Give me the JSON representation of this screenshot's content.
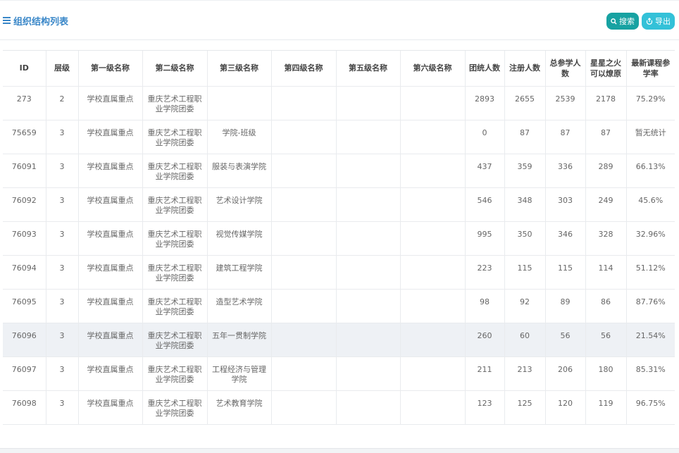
{
  "header": {
    "title": "组织结构列表",
    "search_label": "搜索",
    "export_label": "导出"
  },
  "colors": {
    "title": "#3a87c8",
    "search_button": "#17a2a2",
    "export_button": "#33c1d8",
    "highlight_row": "#eef1f5"
  },
  "table": {
    "columns": [
      "ID",
      "层级",
      "第一级名称",
      "第二级名称",
      "第三级名称",
      "第四级名称",
      "第五级名称",
      "第六级名称",
      "团统人数",
      "注册人数",
      "总参学人数",
      "星星之火可以燎原",
      "最新课程参学率"
    ],
    "rows": [
      [
        "273",
        "2",
        "学校直属重点",
        "重庆艺术工程职业学院团委",
        "",
        "",
        "",
        "",
        "2893",
        "2655",
        "2539",
        "2178",
        "75.29%"
      ],
      [
        "75659",
        "3",
        "学校直属重点",
        "重庆艺术工程职业学院团委",
        "学院-班级",
        "",
        "",
        "",
        "0",
        "87",
        "87",
        "87",
        "暂无统计"
      ],
      [
        "76091",
        "3",
        "学校直属重点",
        "重庆艺术工程职业学院团委",
        "服装与表演学院",
        "",
        "",
        "",
        "437",
        "359",
        "336",
        "289",
        "66.13%"
      ],
      [
        "76092",
        "3",
        "学校直属重点",
        "重庆艺术工程职业学院团委",
        "艺术设计学院",
        "",
        "",
        "",
        "546",
        "348",
        "303",
        "249",
        "45.6%"
      ],
      [
        "76093",
        "3",
        "学校直属重点",
        "重庆艺术工程职业学院团委",
        "视觉传媒学院",
        "",
        "",
        "",
        "995",
        "350",
        "346",
        "328",
        "32.96%"
      ],
      [
        "76094",
        "3",
        "学校直属重点",
        "重庆艺术工程职业学院团委",
        "建筑工程学院",
        "",
        "",
        "",
        "223",
        "115",
        "115",
        "114",
        "51.12%"
      ],
      [
        "76095",
        "3",
        "学校直属重点",
        "重庆艺术工程职业学院团委",
        "造型艺术学院",
        "",
        "",
        "",
        "98",
        "92",
        "89",
        "86",
        "87.76%"
      ],
      [
        "76096",
        "3",
        "学校直属重点",
        "重庆艺术工程职业学院团委",
        "五年一贯制学院",
        "",
        "",
        "",
        "260",
        "60",
        "56",
        "56",
        "21.54%"
      ],
      [
        "76097",
        "3",
        "学校直属重点",
        "重庆艺术工程职业学院团委",
        "工程经济与管理学院",
        "",
        "",
        "",
        "211",
        "213",
        "206",
        "180",
        "85.31%"
      ],
      [
        "76098",
        "3",
        "学校直属重点",
        "重庆艺术工程职业学院团委",
        "艺术教育学院",
        "",
        "",
        "",
        "123",
        "125",
        "120",
        "119",
        "96.75%"
      ]
    ],
    "highlighted_row_index": 7
  }
}
